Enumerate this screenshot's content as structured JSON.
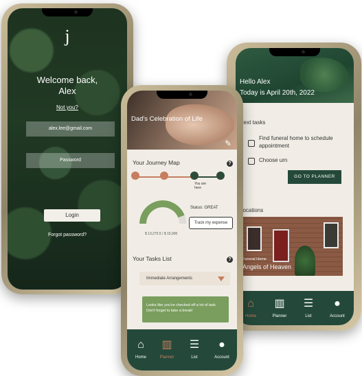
{
  "login_screen": {
    "logo": "j",
    "welcome_line1": "Welcome back,",
    "welcome_line2": "Alex",
    "not_you": "Not you?",
    "email_value": "alex.lee@gmail.com",
    "password_placeholder": "Password",
    "login_label": "Login",
    "forgot_password": "Forgot password?"
  },
  "planner_screen": {
    "header_title": "Dad's Celebration of Life",
    "journey_map_title": "Your Journey Map",
    "you_are_here": "You are here",
    "journey_progress_current_step": 3,
    "journey_steps_total": 4,
    "budget_spent": "$ 13,270.5",
    "budget_total": "$ 15,000",
    "budget_fraction": 0.88,
    "status_text": "Status: GREAT",
    "track_button": "Track my expense",
    "tasks_title": "Your Tasks List",
    "dropdown_selected": "Immediate Arrangements",
    "toast_text": "Looks like you've checked off a lot of task. Don't forget to take a break!",
    "nav": [
      "Home",
      "Planner",
      "List",
      "Account"
    ],
    "active_nav": "Planner"
  },
  "home_screen": {
    "hello": "Hello Alex",
    "today": "Today is April 20th, 2022",
    "next_tasks_title": "Next tasks",
    "tasks": [
      "Find funeral home to schedule appointment",
      "Choose urn"
    ],
    "go_to_planner": "GO TO PLANNER",
    "locations_title": "Locations",
    "location_type": "Funeral Home",
    "location_name": "Angels of Heaven",
    "nav": [
      "Home",
      "Planner",
      "List",
      "Account"
    ],
    "active_nav": "Home"
  },
  "colors": {
    "accent_green": "#24493a",
    "terracotta": "#c77e60",
    "sage": "#7a9e5e",
    "bg": "#f1ede6"
  }
}
